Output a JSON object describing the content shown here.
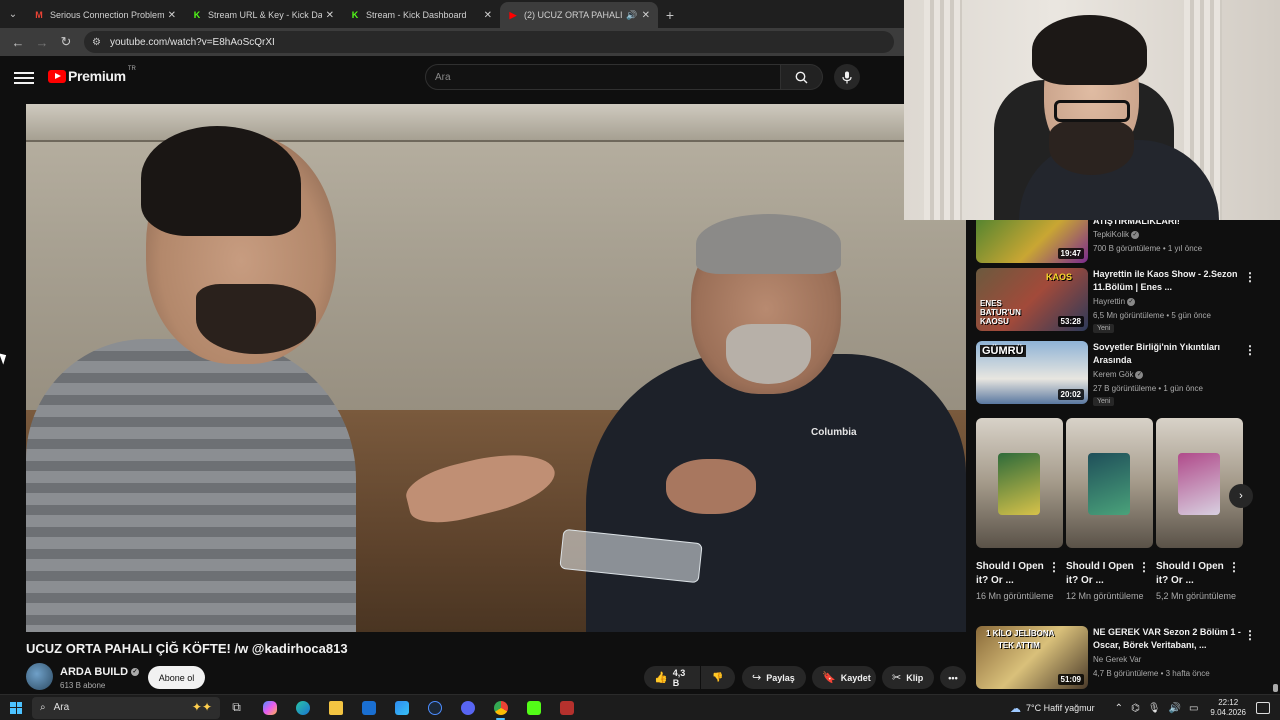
{
  "browser": {
    "tabs": [
      {
        "label": "Serious Connection Problems - ",
        "favicon": "gmail-icon",
        "color": "#ea4335",
        "active": false
      },
      {
        "label": "Stream URL & Key - Kick Dashb",
        "favicon": "kick-icon",
        "color": "#53fc18",
        "active": false
      },
      {
        "label": "Stream - Kick Dashboard",
        "favicon": "kick-icon",
        "color": "#53fc18",
        "active": false
      },
      {
        "label": "(2) UCUZ ORTA PAHALI ÇİĞ",
        "favicon": "youtube-icon",
        "color": "#ff0000",
        "active": true
      }
    ],
    "url": "youtube.com/watch?v=E8hAoScQrXI"
  },
  "youtube": {
    "logo_text": "Premium",
    "country_code": "TR",
    "search_placeholder": "Ara",
    "video": {
      "title": "UCUZ ORTA PAHALI ÇİĞ KÖFTE! /w @kadirhoca813",
      "shirt_brand": "Columbia",
      "channel": "ARDA BUILD",
      "subscribers": "613 B abone",
      "subscribe_label": "Abone ol",
      "likes": "4,3 B",
      "share_label": "Paylaş",
      "save_label": "Kaydet",
      "clip_label": "Klip"
    },
    "recommendations": [
      {
        "title": "ATIŞTIRMALIKLARI!",
        "channel": "TepkiKolik",
        "meta": "700 B görüntüleme • 1 yıl önce",
        "duration": "19:47",
        "new": "",
        "thumb_text": "",
        "thumb_text2": "",
        "thumb_color": "#3a7d2f"
      },
      {
        "title": "Hayrettin ile Kaos Show - 2.Sezon 11.Bölüm | Enes ...",
        "channel": "Hayrettin",
        "meta": "6,5 Mn görüntüleme • 5 gün önce",
        "duration": "53:28",
        "new": "Yeni",
        "thumb_text": "KAOS",
        "thumb_text2": "ENES BATUR'UN KAOSU",
        "thumb_color": "#6b5a3e"
      },
      {
        "title": "Sovyetler Birliği'nin Yıkıntıları Arasında",
        "channel": "Kerem Gök",
        "meta": "27 B görüntüleme • 1 gün önce",
        "duration": "20:02",
        "new": "Yeni",
        "thumb_text": "GÜMRÜ",
        "thumb_text2": "",
        "thumb_color": "#5a78a0"
      },
      {
        "title": "NE GEREK VAR Sezon 2 Bölüm 1 - Oscar, Börek Veritabanı, ...",
        "channel": "Ne Gerek Var",
        "meta": "4,7 B görüntüleme • 3 hafta önce",
        "duration": "51:09",
        "new": "",
        "thumb_text": "1 KİLO JELİBONA",
        "thumb_text2": "TEK ATTIM",
        "thumb_color": "#8a6a3a"
      }
    ],
    "shorts": [
      {
        "title": "Should I Open it? Or ...",
        "views": "16 Mn görüntüleme",
        "card_color": "#2e6b3a"
      },
      {
        "title": "Should I Open it? Or ...",
        "views": "12 Mn görüntüleme",
        "card_color": "#1f4f5a"
      },
      {
        "title": "Should I Open it? Or ...",
        "views": "5,2 Mn görüntüleme",
        "card_color": "#b04a8a"
      }
    ]
  },
  "taskbar": {
    "search_label": "Ara",
    "weather": "7°C  Hafif yağmur",
    "time": "22:12",
    "date": "9.04.2026"
  }
}
